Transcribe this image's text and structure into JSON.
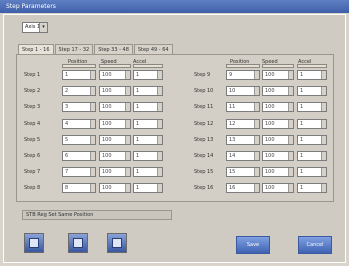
{
  "window": {
    "title": "Step Parameters"
  },
  "selector": {
    "value": "Axis 1"
  },
  "tabs": [
    {
      "label": "Step 1 - 16"
    },
    {
      "label": "Step 17 - 32"
    },
    {
      "label": "Step 33 - 48"
    },
    {
      "label": "Step 49 - 64"
    }
  ],
  "columns": {
    "pos": "Position",
    "speed": "Speed",
    "accel": "Accel"
  },
  "left_rows": [
    {
      "label": "Step 1",
      "pos": "1",
      "speed": "100",
      "accel": "1"
    },
    {
      "label": "Step 2",
      "pos": "2",
      "speed": "100",
      "accel": "1"
    },
    {
      "label": "Step 3",
      "pos": "3",
      "speed": "100",
      "accel": "1"
    },
    {
      "label": "Step 4",
      "pos": "4",
      "speed": "100",
      "accel": "1"
    },
    {
      "label": "Step 5",
      "pos": "5",
      "speed": "100",
      "accel": "1"
    },
    {
      "label": "Step 6",
      "pos": "6",
      "speed": "100",
      "accel": "1"
    },
    {
      "label": "Step 7",
      "pos": "7",
      "speed": "100",
      "accel": "1"
    },
    {
      "label": "Step 8",
      "pos": "8",
      "speed": "100",
      "accel": "1"
    }
  ],
  "right_rows": [
    {
      "label": "Step 9",
      "pos": "9",
      "speed": "100",
      "accel": "1"
    },
    {
      "label": "Step 10",
      "pos": "10",
      "speed": "100",
      "accel": "1"
    },
    {
      "label": "Step 11",
      "pos": "11",
      "speed": "100",
      "accel": "1"
    },
    {
      "label": "Step 12",
      "pos": "12",
      "speed": "100",
      "accel": "1"
    },
    {
      "label": "Step 13",
      "pos": "13",
      "speed": "100",
      "accel": "1"
    },
    {
      "label": "Step 14",
      "pos": "14",
      "speed": "100",
      "accel": "1"
    },
    {
      "label": "Step 15",
      "pos": "15",
      "speed": "100",
      "accel": "1"
    },
    {
      "label": "Step 16",
      "pos": "16",
      "speed": "100",
      "accel": "1"
    }
  ],
  "status": {
    "text": "STB Reg Set Same Position"
  },
  "buttons": {
    "save": "Save",
    "cancel": "Cancel"
  },
  "icons": [
    "home-icon",
    "folder-icon",
    "edit-icon"
  ],
  "colors": {
    "titlebar": "#4a6ab0",
    "button": "#4f72c0",
    "panel": "#cfcbc2"
  }
}
